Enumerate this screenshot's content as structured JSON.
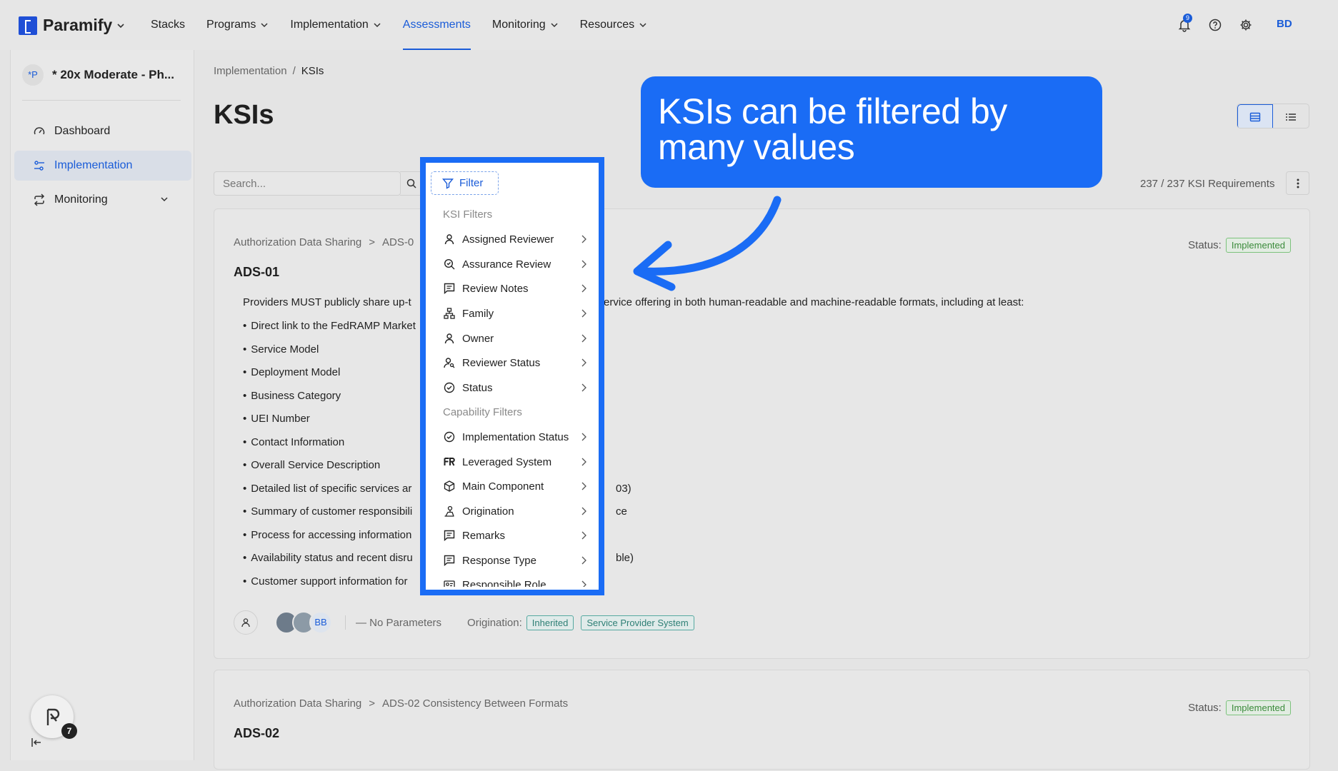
{
  "brand": {
    "name": "Paramify"
  },
  "nav": [
    {
      "label": "Stacks",
      "has_menu": false
    },
    {
      "label": "Programs",
      "has_menu": true
    },
    {
      "label": "Implementation",
      "has_menu": true
    },
    {
      "label": "Assessments",
      "has_menu": false,
      "active": true
    },
    {
      "label": "Monitoring",
      "has_menu": true
    },
    {
      "label": "Resources",
      "has_menu": true
    }
  ],
  "topbar": {
    "notification_count": "9",
    "user_initials": "BD"
  },
  "sidebar": {
    "project_badge": "*P",
    "project_name": "* 20x Moderate - Ph...",
    "items": [
      {
        "label": "Dashboard",
        "icon": "gauge-icon"
      },
      {
        "label": "Implementation",
        "icon": "sliders-icon",
        "active": true
      },
      {
        "label": "Monitoring",
        "icon": "refresh-icon",
        "expandable": true
      }
    ],
    "helper_badge": "7"
  },
  "breadcrumb": {
    "parent": "Implementation",
    "separator": "/",
    "current": "KSIs"
  },
  "page": {
    "title": "KSIs"
  },
  "toolbar": {
    "search_placeholder": "Search...",
    "filter_label": "Filter",
    "requirement_count": "237 / 237 KSI Requirements"
  },
  "cards": [
    {
      "family": "Authorization Data Sharing",
      "family_sep": ">",
      "req_ref": "ADS-0",
      "status_label": "Status:",
      "status": "Implemented",
      "id": "ADS-01",
      "desc_left": "Providers MUST publicly share up-t",
      "desc_right": "ervice offering in both human-readable and machine-readable formats, including at least:",
      "bullets": [
        {
          "left": "Direct link to the FedRAMP Market",
          "right": ""
        },
        {
          "left": "Service Model",
          "right": ""
        },
        {
          "left": "Deployment Model",
          "right": ""
        },
        {
          "left": "Business Category",
          "right": ""
        },
        {
          "left": "UEI Number",
          "right": ""
        },
        {
          "left": "Contact Information",
          "right": ""
        },
        {
          "left": "Overall Service Description",
          "right": ""
        },
        {
          "left": "Detailed list of specific services ar",
          "right": "03)"
        },
        {
          "left": "Summary of customer responsibili",
          "right": "ce"
        },
        {
          "left": "Process for accessing information",
          "right": ""
        },
        {
          "left": "Availability status and recent disru",
          "right": "ble)"
        },
        {
          "left": "Customer support information for",
          "right": ""
        }
      ],
      "reviewer_initials": "BB",
      "parameters": "— No Parameters",
      "origination_label": "Origination:",
      "origination_tags": [
        "Inherited",
        "Service Provider System"
      ]
    },
    {
      "family": "Authorization Data Sharing",
      "family_sep": ">",
      "req_ref": "ADS-02 Consistency Between Formats",
      "status_label": "Status:",
      "status": "Implemented",
      "id": "ADS-02"
    }
  ],
  "filter_menu": {
    "ksi_group": "KSI Filters",
    "ksi_items": [
      {
        "label": "Assigned Reviewer",
        "icon": "user-icon"
      },
      {
        "label": "Assurance Review",
        "icon": "search-check-icon"
      },
      {
        "label": "Review Notes",
        "icon": "message-icon"
      },
      {
        "label": "Family",
        "icon": "hierarchy-icon"
      },
      {
        "label": "Owner",
        "icon": "user-icon"
      },
      {
        "label": "Reviewer Status",
        "icon": "user-search-icon"
      },
      {
        "label": "Status",
        "icon": "check-circle-icon"
      }
    ],
    "capability_group": "Capability Filters",
    "capability_items": [
      {
        "label": "Implementation Status",
        "icon": "check-circle-icon"
      },
      {
        "label": "Leveraged System",
        "icon": "fedramp-icon"
      },
      {
        "label": "Main Component",
        "icon": "cube-icon"
      },
      {
        "label": "Origination",
        "icon": "origin-icon"
      },
      {
        "label": "Remarks",
        "icon": "message-icon"
      },
      {
        "label": "Response Type",
        "icon": "message-icon"
      },
      {
        "label": "Responsible Role",
        "icon": "id-card-icon"
      }
    ]
  },
  "callout": {
    "text": "KSIs can be filtered by many values"
  },
  "colors": {
    "accent": "#1a5cd8",
    "callout": "#1a6cf5",
    "status_green": "#3b8b3b"
  }
}
